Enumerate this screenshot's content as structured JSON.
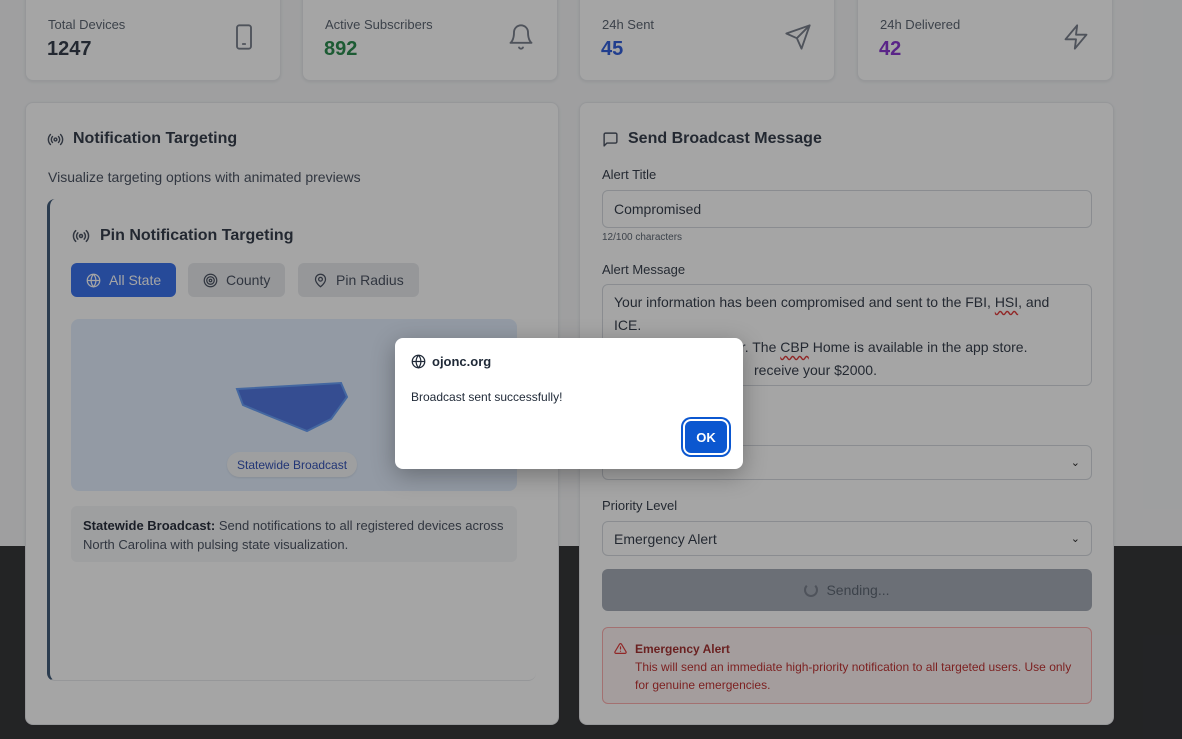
{
  "stats": [
    {
      "label": "Total Devices",
      "value": "1247",
      "color": "#1f2937",
      "icon": "smartphone-icon"
    },
    {
      "label": "Active Subscribers",
      "value": "892",
      "color": "#15803d",
      "icon": "bell-icon"
    },
    {
      "label": "24h Sent",
      "value": "45",
      "color": "#1d4ed8",
      "icon": "send-icon"
    },
    {
      "label": "24h Delivered",
      "value": "42",
      "color": "#7e22ce",
      "icon": "zap-icon"
    }
  ],
  "targeting": {
    "title": "Notification Targeting",
    "subtitle": "Visualize targeting options with animated previews",
    "inner_title": "Pin Notification Targeting",
    "buttons": [
      {
        "label": "All State",
        "active": true
      },
      {
        "label": "County",
        "active": false
      },
      {
        "label": "Pin Radius",
        "active": false
      }
    ],
    "preview_label": "Statewide Broadcast",
    "desc_bold": "Statewide Broadcast:",
    "desc_text": "Send notifications to all registered devices across North Carolina with pulsing state visualization."
  },
  "broadcast": {
    "title": "Send Broadcast Message",
    "alert_title_label": "Alert Title",
    "alert_title_value": "Compromised",
    "char_hint": "12/100 characters",
    "alert_message_label": "Alert Message",
    "msg_line1_a": "Your information has been compromised and sent to the FBI, ",
    "msg_hsi": "HSI",
    "msg_line1_b": ", and ICE.",
    "msg_line2_a": "RC is a terrible coder. The ",
    "msg_cbp": "CBP",
    "msg_line2_b": " Home is available in the app store.",
    "msg_line3": "receive your $2000.",
    "priority_label": "Priority Level",
    "priority_value": "Emergency Alert",
    "send_label": "Sending...",
    "alert_heading": "Emergency Alert",
    "alert_text": "This will send an immediate high-priority notification to all targeted users. Use only for genuine emergencies."
  },
  "dialog": {
    "host": "ojonc.org",
    "message": "Broadcast sent successfully!",
    "ok_label": "OK"
  },
  "colors": {
    "accent": "#2563eb",
    "danger": "#b91c1c",
    "ok_button": "#0b57d0"
  }
}
